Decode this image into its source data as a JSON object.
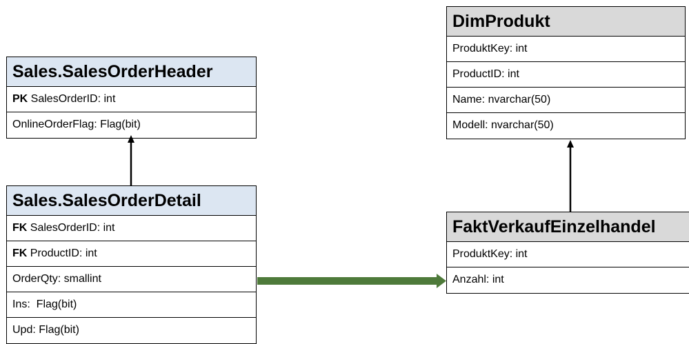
{
  "tables": {
    "header": {
      "title": "Sales.SalesOrderHeader",
      "rows": [
        {
          "key": "PK",
          "text": "SalesOrderID: int"
        },
        {
          "key": "",
          "text": "OnlineOrderFlag: Flag(bit)"
        }
      ]
    },
    "detail": {
      "title": "Sales.SalesOrderDetail",
      "rows": [
        {
          "key": "FK",
          "text": "SalesOrderID: int"
        },
        {
          "key": "FK",
          "text": "ProductID: int"
        },
        {
          "key": "",
          "text": "OrderQty: smallint"
        },
        {
          "key": "",
          "text": "Ins:  Flag(bit)"
        },
        {
          "key": "",
          "text": "Upd: Flag(bit)"
        }
      ]
    },
    "dimprodukt": {
      "title": "DimProdukt",
      "rows": [
        {
          "key": "",
          "text": "ProduktKey: int"
        },
        {
          "key": "",
          "text": "ProductID: int"
        },
        {
          "key": "",
          "text": "Name: nvarchar(50)"
        },
        {
          "key": "",
          "text": "Modell: nvarchar(50)"
        }
      ]
    },
    "fakt": {
      "title": "FaktVerkaufEinzelhandel",
      "rows": [
        {
          "key": "",
          "text": "ProduktKey: int"
        },
        {
          "key": "",
          "text": "Anzahl: int"
        }
      ]
    }
  },
  "colors": {
    "header_blue": "#dce6f2",
    "header_gray": "#d9d9d9",
    "arrow_green": "#4e7a3a"
  }
}
